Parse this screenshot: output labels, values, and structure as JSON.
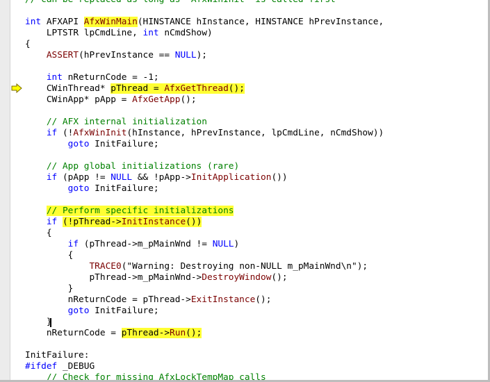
{
  "editor": {
    "lines": [
      {
        "parts": [
          {
            "t": "// can be replaced as long as 'AfxWinInit' is called first",
            "c": "cm"
          }
        ]
      },
      {
        "parts": []
      },
      {
        "parts": [
          {
            "t": "int",
            "c": "kw"
          },
          {
            "t": " AFXAPI ",
            "c": ""
          },
          {
            "t": "AfxWinMain",
            "c": "fn hl"
          },
          {
            "t": "(HINSTANCE hInstance, HINSTANCE hPrevInstance,",
            "c": ""
          }
        ]
      },
      {
        "parts": [
          {
            "t": "    LPTSTR lpCmdLine, ",
            "c": ""
          },
          {
            "t": "int",
            "c": "kw"
          },
          {
            "t": " nCmdShow)",
            "c": ""
          }
        ]
      },
      {
        "parts": [
          {
            "t": "{",
            "c": ""
          }
        ]
      },
      {
        "parts": [
          {
            "t": "    ",
            "c": ""
          },
          {
            "t": "ASSERT",
            "c": "fn"
          },
          {
            "t": "(hPrevInstance == ",
            "c": ""
          },
          {
            "t": "NULL",
            "c": "kw"
          },
          {
            "t": ");",
            "c": ""
          }
        ]
      },
      {
        "parts": []
      },
      {
        "parts": [
          {
            "t": "    ",
            "c": ""
          },
          {
            "t": "int",
            "c": "kw"
          },
          {
            "t": " nReturnCode = -1;",
            "c": ""
          }
        ]
      },
      {
        "parts": [
          {
            "t": "    CWinThread* ",
            "c": ""
          },
          {
            "t": "pThread = ",
            "c": "hl"
          },
          {
            "t": "AfxGetThread",
            "c": "fn hl"
          },
          {
            "t": "();",
            "c": "hl"
          }
        ]
      },
      {
        "parts": [
          {
            "t": "    CWinApp* pApp = ",
            "c": ""
          },
          {
            "t": "AfxGetApp",
            "c": "fn"
          },
          {
            "t": "();",
            "c": ""
          }
        ]
      },
      {
        "parts": []
      },
      {
        "parts": [
          {
            "t": "    // AFX internal initialization",
            "c": "cm"
          }
        ]
      },
      {
        "parts": [
          {
            "t": "    ",
            "c": ""
          },
          {
            "t": "if",
            "c": "kw"
          },
          {
            "t": " (!",
            "c": ""
          },
          {
            "t": "AfxWinInit",
            "c": "fn"
          },
          {
            "t": "(hInstance, hPrevInstance, lpCmdLine, nCmdShow))",
            "c": ""
          }
        ]
      },
      {
        "parts": [
          {
            "t": "        ",
            "c": ""
          },
          {
            "t": "goto",
            "c": "kw"
          },
          {
            "t": " InitFailure;",
            "c": ""
          }
        ]
      },
      {
        "parts": []
      },
      {
        "parts": [
          {
            "t": "    // App global initializations (rare)",
            "c": "cm"
          }
        ]
      },
      {
        "parts": [
          {
            "t": "    ",
            "c": ""
          },
          {
            "t": "if",
            "c": "kw"
          },
          {
            "t": " (pApp != ",
            "c": ""
          },
          {
            "t": "NULL",
            "c": "kw"
          },
          {
            "t": " && !pApp->",
            "c": ""
          },
          {
            "t": "InitApplication",
            "c": "fn"
          },
          {
            "t": "())",
            "c": ""
          }
        ]
      },
      {
        "parts": [
          {
            "t": "        ",
            "c": ""
          },
          {
            "t": "goto",
            "c": "kw"
          },
          {
            "t": " InitFailure;",
            "c": ""
          }
        ]
      },
      {
        "parts": []
      },
      {
        "parts": [
          {
            "t": "    ",
            "c": ""
          },
          {
            "t": "// Perform specific initializations",
            "c": "cm hl"
          }
        ]
      },
      {
        "parts": [
          {
            "t": "    ",
            "c": ""
          },
          {
            "t": "if",
            "c": "kw"
          },
          {
            "t": " ",
            "c": ""
          },
          {
            "t": "(!pThread->",
            "c": "hl"
          },
          {
            "t": "InitInstance",
            "c": "fn hl"
          },
          {
            "t": "())",
            "c": "hl"
          }
        ]
      },
      {
        "parts": [
          {
            "t": "    {",
            "c": ""
          }
        ]
      },
      {
        "parts": [
          {
            "t": "        ",
            "c": ""
          },
          {
            "t": "if",
            "c": "kw"
          },
          {
            "t": " (pThread->m_pMainWnd != ",
            "c": ""
          },
          {
            "t": "NULL",
            "c": "kw"
          },
          {
            "t": ")",
            "c": ""
          }
        ]
      },
      {
        "parts": [
          {
            "t": "        {",
            "c": ""
          }
        ]
      },
      {
        "parts": [
          {
            "t": "            ",
            "c": ""
          },
          {
            "t": "TRACE0",
            "c": "fn"
          },
          {
            "t": "(",
            "c": ""
          },
          {
            "t": "\"Warning: Destroying non-NULL m_pMainWnd\\n\"",
            "c": ""
          },
          {
            "t": ");",
            "c": ""
          }
        ]
      },
      {
        "parts": [
          {
            "t": "            pThread->m_pMainWnd->",
            "c": ""
          },
          {
            "t": "DestroyWindow",
            "c": "fn"
          },
          {
            "t": "();",
            "c": ""
          }
        ]
      },
      {
        "parts": [
          {
            "t": "        }",
            "c": ""
          }
        ]
      },
      {
        "parts": [
          {
            "t": "        nReturnCode = pThread->",
            "c": ""
          },
          {
            "t": "ExitInstance",
            "c": "fn"
          },
          {
            "t": "();",
            "c": ""
          }
        ]
      },
      {
        "parts": [
          {
            "t": "        ",
            "c": ""
          },
          {
            "t": "goto",
            "c": "kw"
          },
          {
            "t": " InitFailure;",
            "c": ""
          }
        ]
      },
      {
        "parts": [
          {
            "t": "    }",
            "c": ""
          }
        ]
      },
      {
        "parts": [
          {
            "t": "    nReturnCode = ",
            "c": ""
          },
          {
            "t": "pThread->",
            "c": "hl"
          },
          {
            "t": "Run",
            "c": "fn hl"
          },
          {
            "t": "();",
            "c": "hl"
          }
        ]
      },
      {
        "parts": []
      },
      {
        "parts": [
          {
            "t": "InitFailure:",
            "c": ""
          }
        ]
      },
      {
        "parts": [
          {
            "t": "#ifdef",
            "c": "pp"
          },
          {
            "t": " _DEBUG",
            "c": ""
          }
        ]
      },
      {
        "parts": [
          {
            "t": "    // Check for missing AfxLockTempMap calls",
            "c": "cm"
          }
        ]
      }
    ],
    "colors": {
      "keyword": "#0000ff",
      "function": "#7a0000",
      "comment": "#008000",
      "highlight": "#ffff33",
      "arrow": "#ffff00"
    },
    "icons": {
      "execution_pointer": "current-statement-arrow-icon"
    }
  }
}
